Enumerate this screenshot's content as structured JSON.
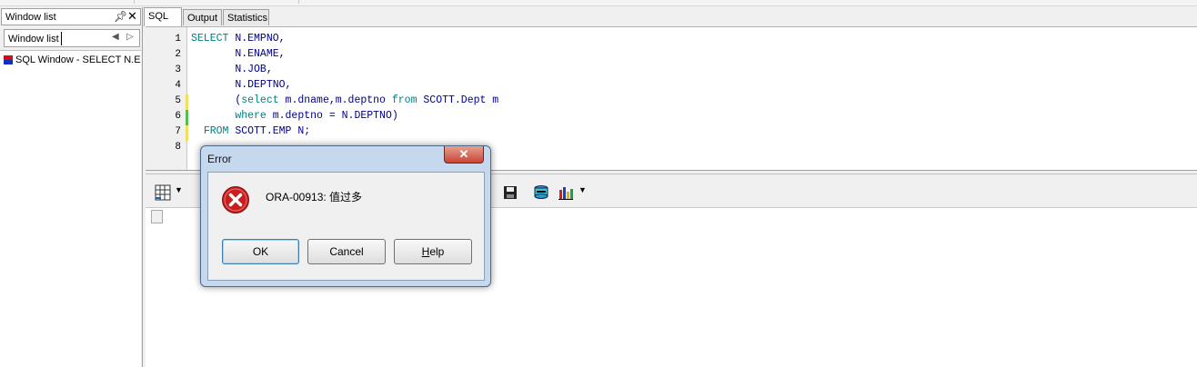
{
  "window_list": {
    "title": "Window list",
    "search_value": "Window list",
    "items": [
      {
        "label": "SQL Window - SELECT N.EMPNO"
      }
    ]
  },
  "tabs": [
    {
      "label": "SQL",
      "active": true
    },
    {
      "label": "Output",
      "active": false
    },
    {
      "label": "Statistics",
      "active": false
    }
  ],
  "editor": {
    "line_numbers": [
      "1",
      "2",
      "3",
      "4",
      "5",
      "6",
      "7",
      "8"
    ],
    "lines": [
      {
        "kw": "SELECT",
        "rest": " N.EMPNO,",
        "indent": ""
      },
      {
        "kw": "",
        "rest": "N.ENAME,",
        "indent": "       "
      },
      {
        "kw": "",
        "rest": "N.JOB,",
        "indent": "       "
      },
      {
        "kw": "",
        "rest": "N.DEPTNO,",
        "indent": "       "
      },
      {
        "kw": "",
        "rest": "",
        "indent": "       "
      },
      {
        "kw": "where",
        "rest": " m.deptno = N.DEPTNO)",
        "indent": "       "
      },
      {
        "kw": "FROM",
        "rest": " SCOTT.EMP N;",
        "indent": "  "
      },
      {
        "kw": "",
        "rest": "",
        "indent": ""
      }
    ],
    "line5": {
      "open": "(",
      "kw1": "select",
      "mid": " m.dname,m.deptno ",
      "kw2": "from",
      "tail": " SCOTT.Dept m"
    }
  },
  "dialog": {
    "title": "Error",
    "close_label": "✕",
    "message": "ORA-00913: 值过多",
    "buttons": {
      "ok": "OK",
      "cancel": "Cancel",
      "help_first": "H",
      "help_rest": "elp"
    }
  },
  "colors": {
    "keyword": "#008080",
    "identifier": "#00008b",
    "error_red": "#c81e1e"
  }
}
